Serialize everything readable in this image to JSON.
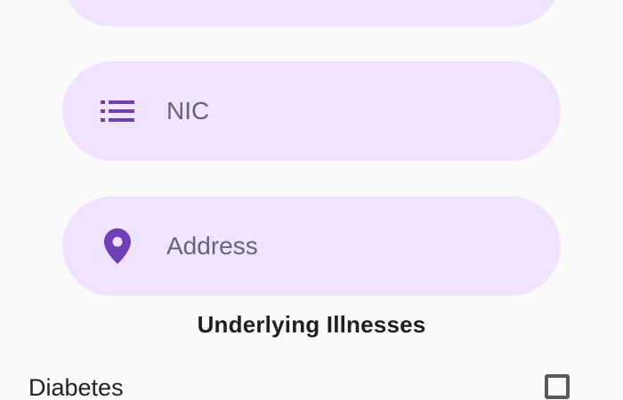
{
  "form": {
    "nic": {
      "placeholder": "NIC",
      "icon": "list-icon"
    },
    "address": {
      "placeholder": "Address",
      "icon": "location-pin-icon"
    }
  },
  "illnesses": {
    "section_title": "Underlying Illnesses",
    "items": [
      {
        "label": "Diabetes",
        "checked": false
      }
    ]
  },
  "colors": {
    "field_background": "#efe3ff",
    "accent": "#6f3fb3",
    "page_background": "#fafafa"
  }
}
